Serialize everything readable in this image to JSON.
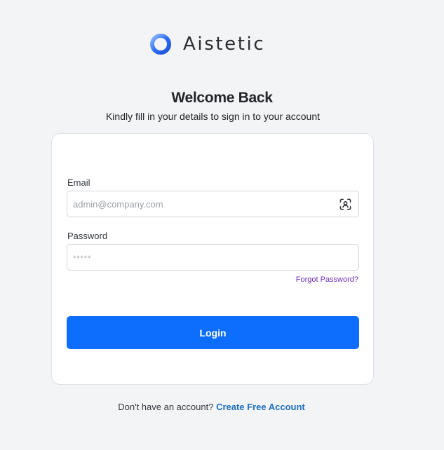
{
  "brand": {
    "name": "Aistetic",
    "icon": "ring-logo-icon",
    "color_primary": "#2f6df2",
    "color_secondary": "#7fb0ff"
  },
  "header": {
    "title": "Welcome Back",
    "subtitle": "Kindly fill in your details to sign in to your account"
  },
  "form": {
    "email": {
      "label": "Email",
      "value": "",
      "placeholder": "admin@company.com",
      "icon": "face-scan-icon"
    },
    "password": {
      "label": "Password",
      "value": "",
      "placeholder": "*****"
    },
    "forgot_label": "Forgot Password?",
    "login_label": "Login"
  },
  "footer": {
    "prompt": "Don't have an account?",
    "link_label": "Create Free Account"
  },
  "colors": {
    "background": "#f3f4f6",
    "card": "#ffffff",
    "button": "#0d6efd",
    "forgot_link": "#6f2fbd",
    "signup_link": "#1f6fbf"
  }
}
